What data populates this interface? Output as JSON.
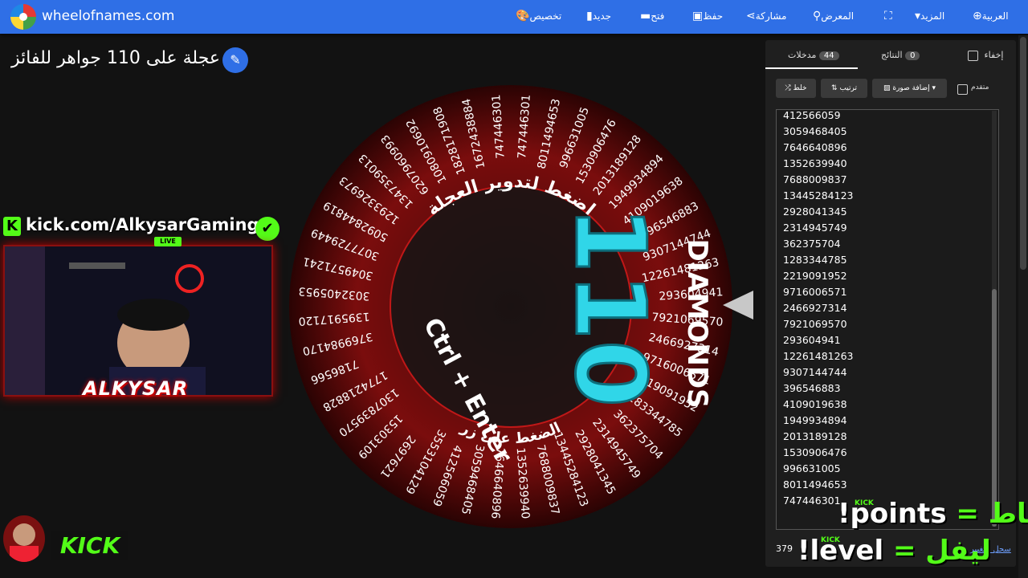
{
  "header": {
    "site_name": "wheelofnames.com",
    "nav": {
      "language": "العربية",
      "more": "المزيد",
      "gallery": "المعرض",
      "share": "مشاركة",
      "save": "حفظ",
      "open": "فتح",
      "new": "جديد",
      "customize": "تخصيص"
    }
  },
  "title": "عجلة على 110 جواهر للفائز",
  "wheel": {
    "center_lines": [
      "اضغط لتدوير العجلة",
      "Ctrl + Enter",
      "الضغط على زر"
    ],
    "overlay_big_text": "110",
    "overlay_side_text": "DIAMONDS",
    "segments": [
      "747446301",
      "8011494653",
      "996631005",
      "1530906476",
      "2013189128",
      "1949934894",
      "4109019638",
      "396546883",
      "9307144744",
      "12261481263",
      "293604941",
      "7921069570",
      "2466927314",
      "9716006571",
      "2219091952",
      "1283344785",
      "362375704",
      "2314945749",
      "2928041345",
      "13445284123",
      "7688009837",
      "1352639940",
      "7646640896",
      "3059468405",
      "412566059",
      "3553104129",
      "2697621",
      "15303109",
      "1307839570",
      "1774218828",
      "7186566",
      "3769984170",
      "1395917120",
      "3032405953",
      "3049571241",
      "3077729449",
      "5092844819",
      "1293326973",
      "1347359013",
      "6207960993",
      "1080910692",
      "1828171908",
      "1672438884",
      "747446301"
    ]
  },
  "overlay": {
    "kick_handle": "kick.com/AlkysarGaming",
    "live_label": "LIVE",
    "streamer_name": "ALKYSAR",
    "bottom_kick": "KICK",
    "points_cmd_ar": "نقاط",
    "points_cmd_en": "!points",
    "level_cmd_ar": "ليفل",
    "level_cmd_en": "!level",
    "equals": "=",
    "kick_small": "KICK"
  },
  "panel": {
    "tabs": {
      "entries_label": "مدخلات",
      "entries_count": "44",
      "results_label": "النتائج",
      "results_count": "0",
      "hide_label": "إخفاء"
    },
    "tools": {
      "shuffle": "خلط",
      "sort": "ترتيب",
      "add_image": "إضافة صورة",
      "advanced": "متقدم"
    },
    "entries": [
      "412566059",
      "3059468405",
      "7646640896",
      "1352639940",
      "7688009837",
      "13445284123",
      "2928041345",
      "2314945749",
      "362375704",
      "1283344785",
      "2219091952",
      "9716006571",
      "2466927314",
      "7921069570",
      "293604941",
      "12261481263",
      "9307144744",
      "396546883",
      "4109019638",
      "1949934894",
      "2013189128",
      "1530906476",
      "996631005",
      "8011494653",
      "747446301"
    ],
    "version": "379",
    "changelog": "سجل التغيير"
  },
  "colors": {
    "accent": "#2f6fe6",
    "kick_green": "#53fc18",
    "wheel_red": "#7a0d0d"
  }
}
